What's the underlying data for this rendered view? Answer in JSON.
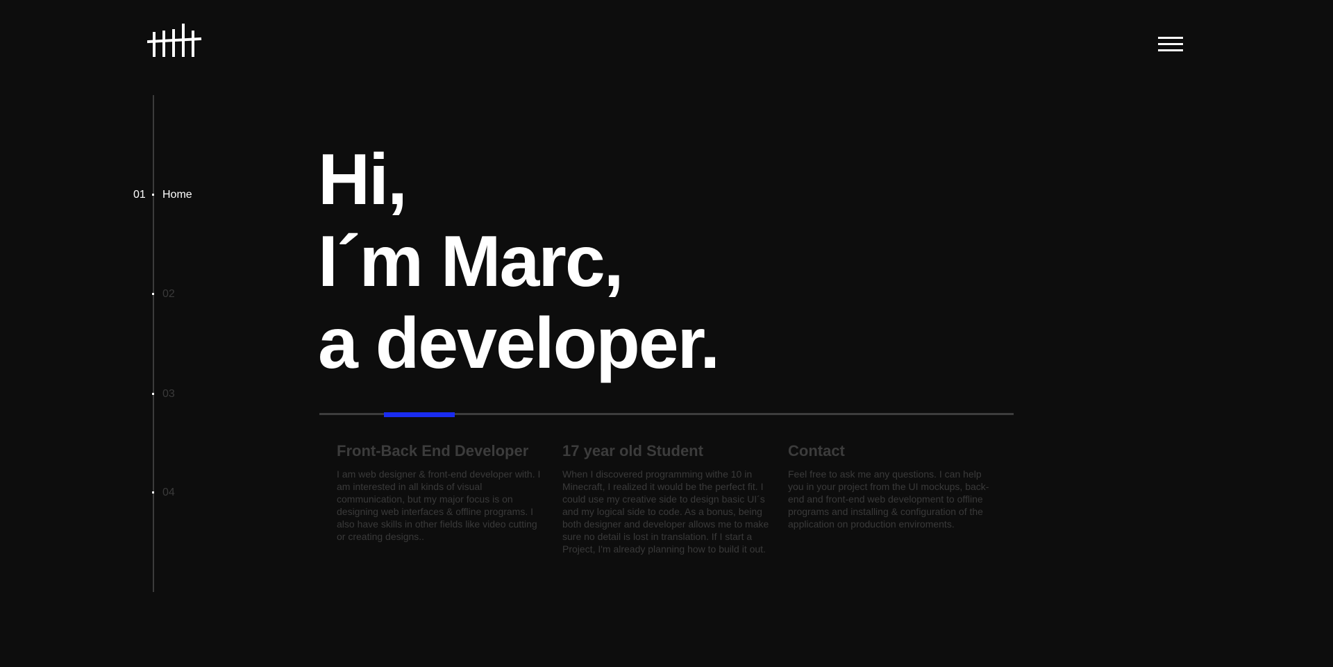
{
  "header": {
    "logo_icon": "tally-marks-logo-icon",
    "menu_icon": "hamburger-menu-icon"
  },
  "side_nav": {
    "items": [
      {
        "index": "01",
        "label": "Home",
        "active": true
      },
      {
        "label": "02",
        "active": false
      },
      {
        "label": "03",
        "active": false
      },
      {
        "label": "04",
        "active": false
      }
    ]
  },
  "hero": {
    "line1": "Hi,",
    "line2": "I´m Marc,",
    "line3": "a developer."
  },
  "slider": {
    "accent_color": "#1a2cf0"
  },
  "columns": [
    {
      "title": "Front-Back End Developer",
      "text": "I am web designer & front-end developer with. I am interested in all kinds of visual communication, but my major focus is on designing web interfaces & offline programs. I also have skills in other fields like video cutting or creating designs.."
    },
    {
      "title": "17 year old Student",
      "text": "When I discovered programming withe 10 in Minecraft, I realized it would be the perfect fit. I could use my creative side to design basic UI´s and my logical side to code. As a bonus, being both designer and developer allows me to make sure no detail is lost in translation. If I start a Project, I'm already planning how to build it out."
    },
    {
      "title": "Contact",
      "text": "Feel free to ask me any questions. I can help you in your project from the UI mockups, back-end and front-end web development to offline programs and installing & configuration of the application on production enviroments."
    }
  ]
}
